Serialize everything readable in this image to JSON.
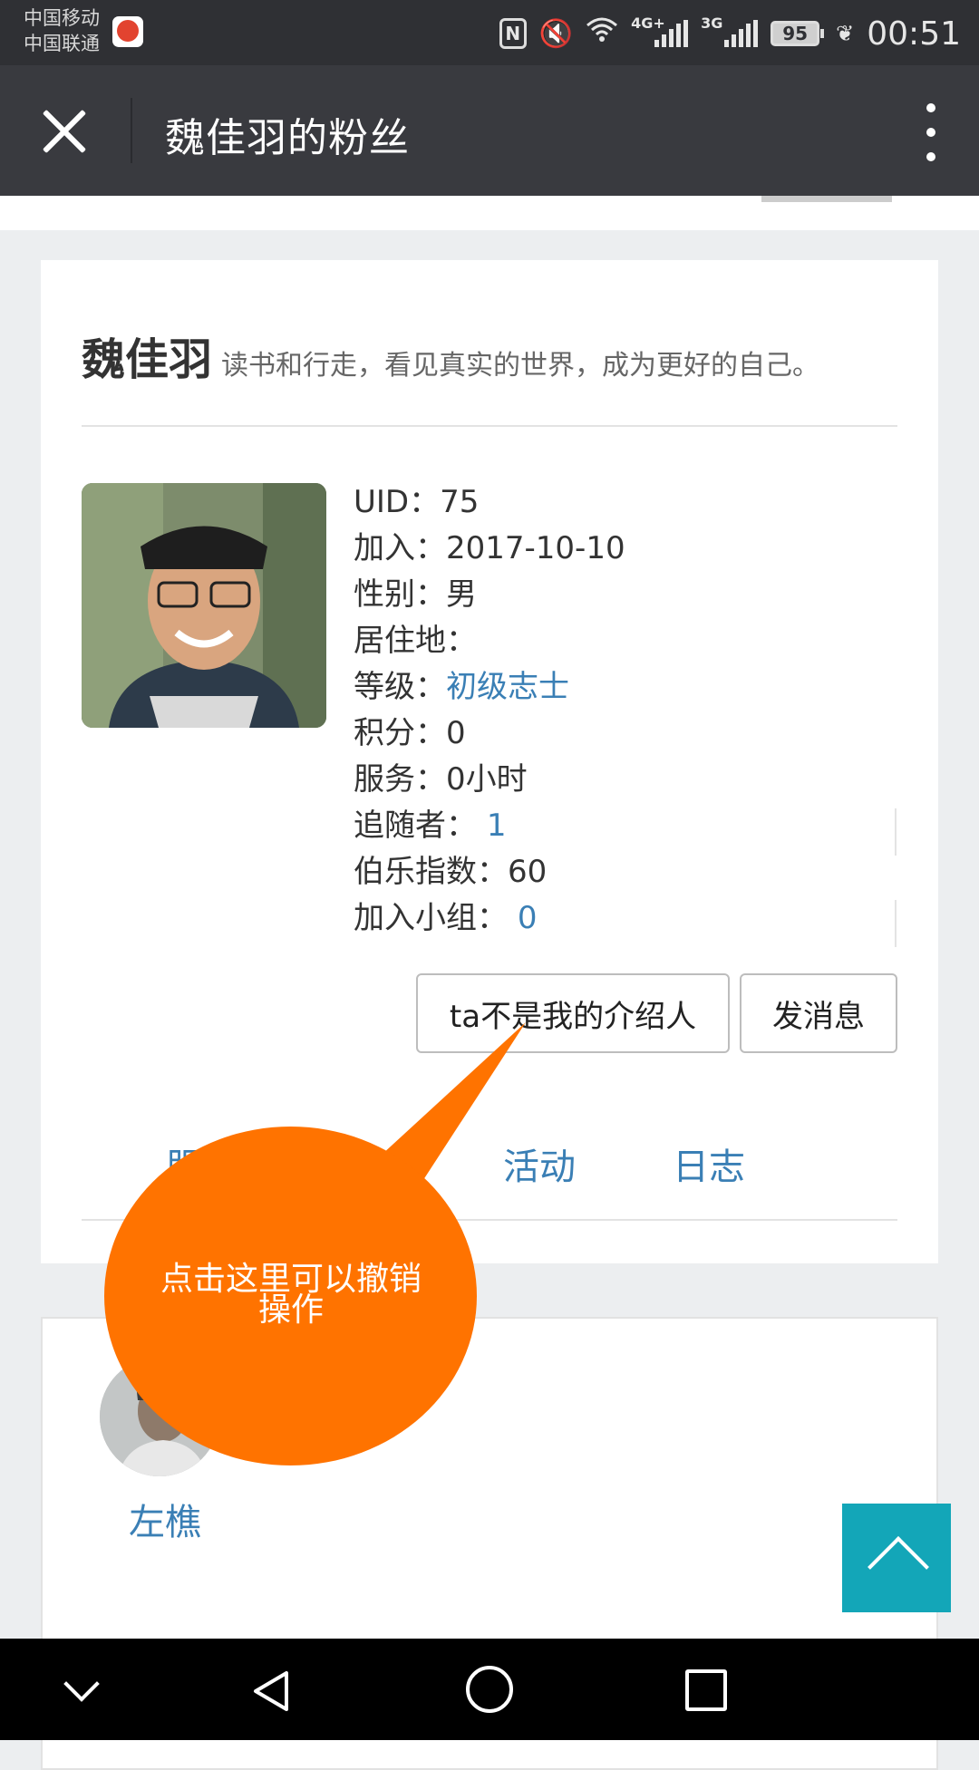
{
  "status_bar": {
    "carrier1": "中国移动",
    "carrier2": "中国联通",
    "network1": "4G+",
    "network2": "3G",
    "battery": "95",
    "time": "00:51"
  },
  "header": {
    "title": "魏佳羽的粉丝"
  },
  "profile": {
    "name": "魏佳羽",
    "motto": "读书和行走，看见真实的世界，成为更好的自己。",
    "uid_label": "UID：",
    "uid": "75",
    "join_label": "加入：",
    "join": "2017-10-10",
    "gender_label": "性别：",
    "gender": "男",
    "residence_label": "居住地：",
    "residence": "",
    "level_label": "等级：",
    "level": "初级志士",
    "points_label": "积分：",
    "points": "0",
    "service_label": "服务：",
    "service": "0小时",
    "followers_label": "追随者：",
    "followers": "1",
    "bole_label": "伯乐指数：",
    "bole": "60",
    "groups_label": "加入小组：",
    "groups": "0"
  },
  "actions": {
    "intro_button": "ta不是我的介绍人",
    "message_button": "发消息"
  },
  "tabs": [
    "服务",
    "活动",
    "日志"
  ],
  "tooltip": {
    "text": "点击这里可以撤销操作"
  },
  "followers_list": [
    {
      "name": "左樵"
    }
  ],
  "colors": {
    "header_bg": "#393a3f",
    "link": "#3a7fb5",
    "tooltip": "#ff7300",
    "to_top": "#13a6b8"
  }
}
